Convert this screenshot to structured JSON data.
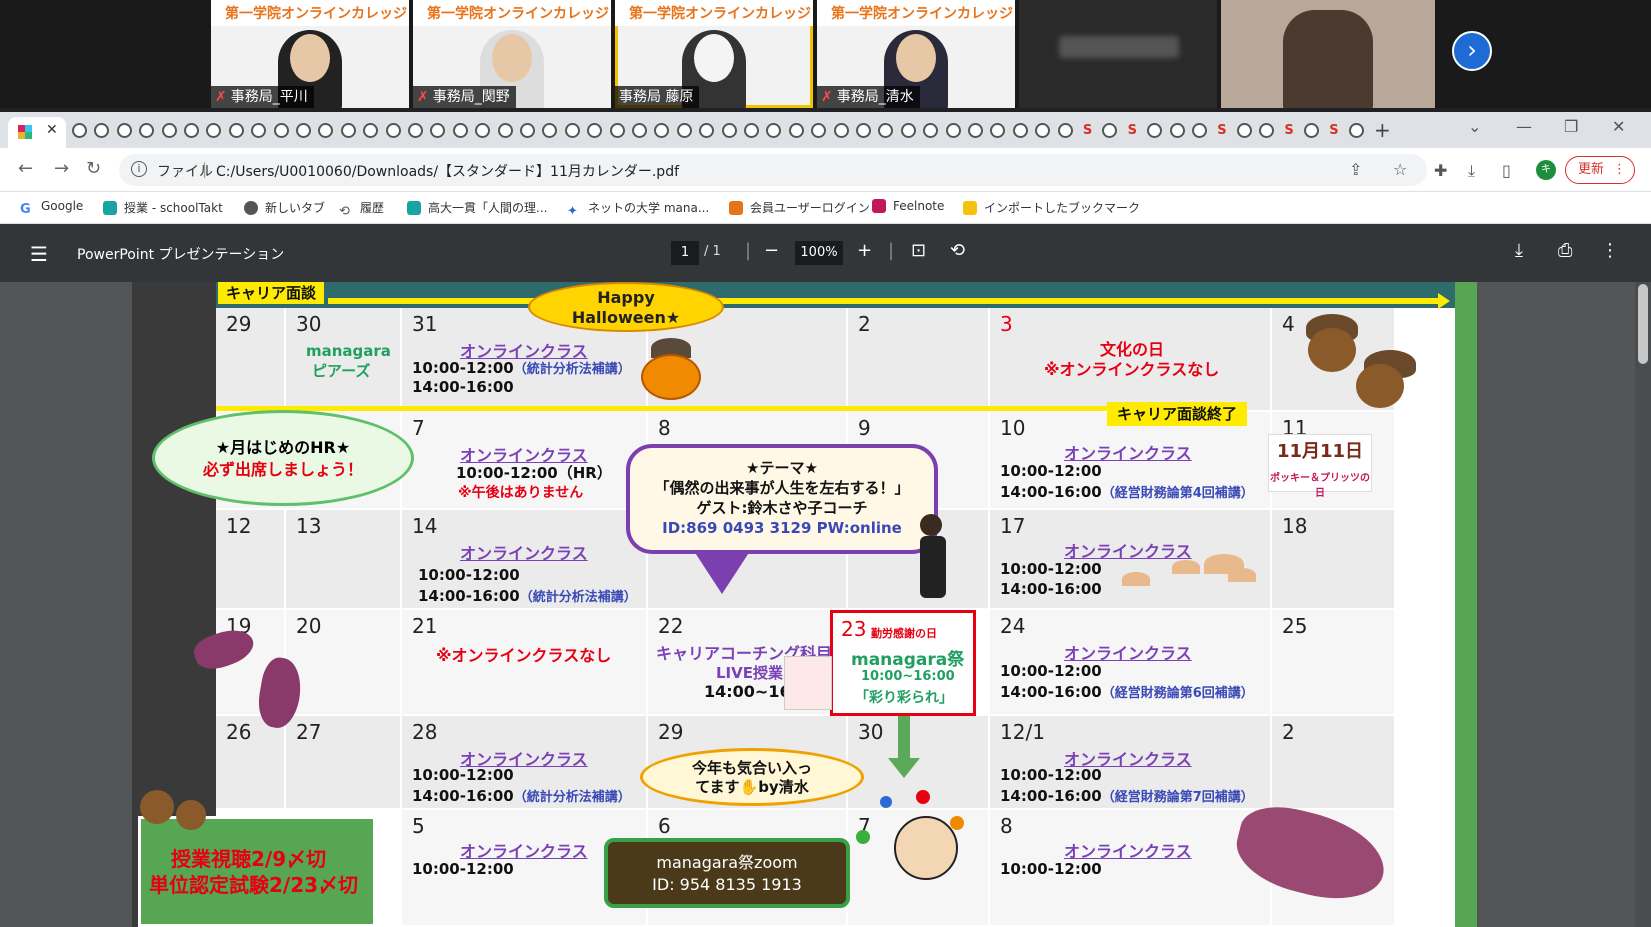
{
  "video_tiles": [
    {
      "banner": "第一学院オンラインカレッジ",
      "name": "事務局_平川"
    },
    {
      "banner": "第一学院オンラインカレッジ",
      "name": "事務局_関野"
    },
    {
      "banner": "第一学院オンラインカレッジ",
      "name": "事務局 藤原"
    },
    {
      "banner": "第一学院オンラインカレッジ",
      "name": "事務局_清水"
    },
    {
      "banner": "",
      "name": ""
    },
    {
      "banner": "",
      "name": ""
    }
  ],
  "browser": {
    "address": {
      "scheme": "ファイル",
      "url": "C:/Users/U0010060/Downloads/【スタンダード】11月カレンダー.pdf"
    },
    "update_label": "更新",
    "profile_initial": "キ",
    "bookmarks": [
      {
        "label": "Google",
        "color": "#4285f4"
      },
      {
        "label": "授業 - schoolTakt",
        "color": "#1aa3a3"
      },
      {
        "label": "新しいタブ",
        "color": "#555555"
      },
      {
        "label": "履歴",
        "color": "#555555"
      },
      {
        "label": "高大一貫「人間の理...",
        "color": "#1aa3a3"
      },
      {
        "label": "ネットの大学 mana...",
        "color": "#2a6ad6"
      },
      {
        "label": "会員ユーザーログイン",
        "color": "#e8731a"
      },
      {
        "label": "Feelnote",
        "color": "#c2185b"
      },
      {
        "label": "インポートしたブックマーク",
        "color": "#f4c20d"
      }
    ]
  },
  "pdf": {
    "title": "PowerPoint プレゼンテーション",
    "page_current": "1",
    "page_total": "/  1",
    "zoom": "100%"
  },
  "calendar": {
    "career_label": "キャリア面談",
    "career_end": "キャリア面談終了",
    "halloween": [
      "Happy",
      "Halloween★"
    ],
    "online_class": "オンラインクラス",
    "week1": {
      "d1": "29",
      "d2": "30",
      "d2_text": [
        "managara",
        "ピアーズ"
      ],
      "d3": "31",
      "d3_t1": "10:00-12:00",
      "d3_t1b": "（統計分析法補講）",
      "d3_t2": "14:00-16:00",
      "d5": "2",
      "d6": "3",
      "d6_text": [
        "文化の日",
        "※オンラインクラスなし"
      ],
      "d7": "4"
    },
    "week2": {
      "d3": "7",
      "d3_t1": "10:00-12:00（HR）",
      "d3_note": "※午後はありません",
      "d4": "8",
      "d5": "9",
      "d6": "10",
      "d6_t1": "10:00-12:00",
      "d6_t2": "14:00-16:00",
      "d6_t2b": "（経営財務論第4回補講）",
      "d7": "11",
      "pocky_date": "11月11日",
      "pocky_caption": "ポッキー＆プリッツの日"
    },
    "hr_bubble": [
      "★月はじめのHR★",
      "必ず出席しましょう！"
    ],
    "theme": [
      "★テーマ★",
      "「偶然の出来事が人生を左右する！」",
      "ゲスト:鈴木さや子コーチ",
      "ID:869 0493  3129  PW:online"
    ],
    "week3": {
      "d1": "12",
      "d2": "13",
      "d3": "14",
      "d3_t1": "10:00-12:00",
      "d3_t2": "14:00-16:00",
      "d3_t2b": "（統計分析法補講）",
      "d6": "17",
      "d6_t1": "10:00-12:00",
      "d6_t2": "14:00-16:00",
      "d7": "18"
    },
    "week4": {
      "d1": "19",
      "d2": "20",
      "d3": "21",
      "d3_note": "※オンラインクラスなし",
      "d4": "22",
      "d4_text": [
        "キャリアコーチング科目",
        "LIVE授業",
        "14:00~16:00"
      ],
      "d5": "23",
      "d5_holiday": "勤労感謝の日",
      "d5_text": [
        "managara祭",
        "10:00~16:00",
        "「彩り彩られ」"
      ],
      "d6": "24",
      "d6_t1": "10:00-12:00",
      "d6_t2": "14:00-16:00",
      "d6_t2b": "（経営財務論第6回補講）",
      "d7": "25"
    },
    "week5": {
      "d1": "26",
      "d2": "27",
      "d3": "28",
      "d3_t1": "10:00-12:00",
      "d3_t2": "14:00-16:00",
      "d3_t2b": "（統計分析法補講）",
      "d4": "29",
      "d5": "30",
      "d6": "12/1",
      "d6_t1": "10:00-12:00",
      "d6_t2": "14:00-16:00",
      "d6_t2b": "（経営財務論第7回補講）",
      "d7": "2"
    },
    "kimochi": [
      "今年も気合い入っ",
      "てます✋by清水"
    ],
    "week6": {
      "d3": "5",
      "d3_t1": "10:00-12:00",
      "d4": "6",
      "d5": "7",
      "d6": "8",
      "d6_t1": "10:00-12:00"
    },
    "zoom_box": [
      "managara祭zoom",
      "ID: 954  8135  1913"
    ],
    "deadline": [
      "授業視聴2/9〆切",
      "単位認定試験2/23〆切"
    ]
  }
}
